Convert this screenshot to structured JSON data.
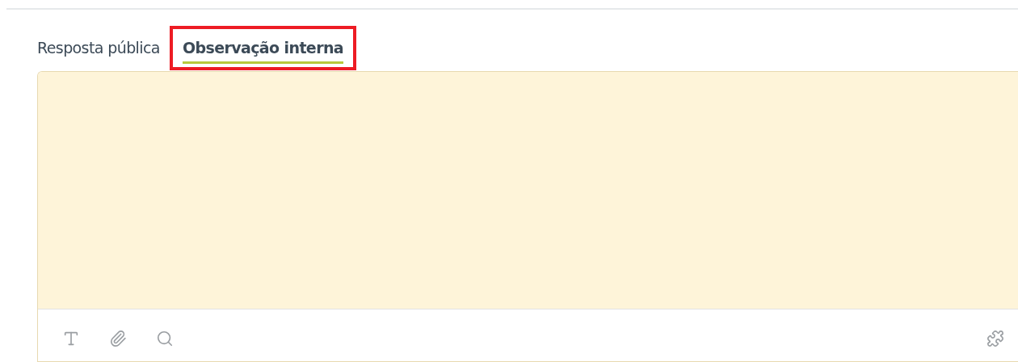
{
  "tabs": [
    {
      "label": "Resposta pública",
      "selected": false,
      "highlighted": false
    },
    {
      "label": "Observação interna",
      "selected": true,
      "highlighted": true
    }
  ],
  "editor": {
    "kind": "internal"
  },
  "toolbar": {
    "left": [
      {
        "kind": "text"
      },
      {
        "kind": "attach"
      },
      {
        "kind": "search"
      }
    ],
    "right": [
      {
        "kind": "apps"
      }
    ]
  }
}
